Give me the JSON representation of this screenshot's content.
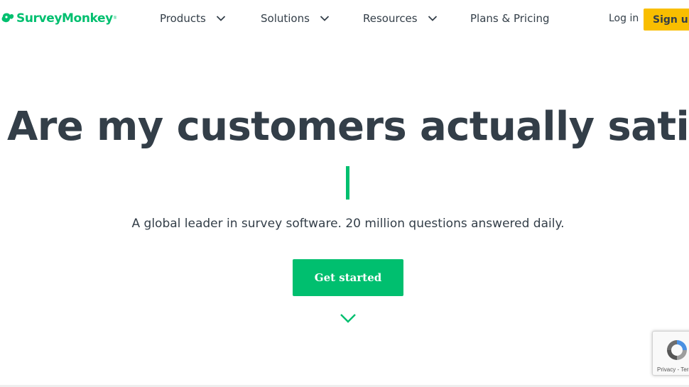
{
  "brand": {
    "name": "SurveyMonkey",
    "trademark": "®",
    "accent_color": "#00bf6f"
  },
  "nav": {
    "items": [
      {
        "label": "Products",
        "has_dropdown": true
      },
      {
        "label": "Solutions",
        "has_dropdown": true
      },
      {
        "label": "Resources",
        "has_dropdown": true
      },
      {
        "label": "Plans & Pricing",
        "has_dropdown": false
      }
    ],
    "login_label": "Log in",
    "signup_label": "Sign up",
    "signup_color": "#f9be00"
  },
  "hero": {
    "title": "Are my customers actually satisfied?",
    "subtitle": "A global leader in survey software. 20 million questions answered daily.",
    "cta_label": "Get started",
    "scroll_icon": "chevron-down-icon"
  },
  "recaptcha": {
    "text": "Privacy - Terms"
  }
}
